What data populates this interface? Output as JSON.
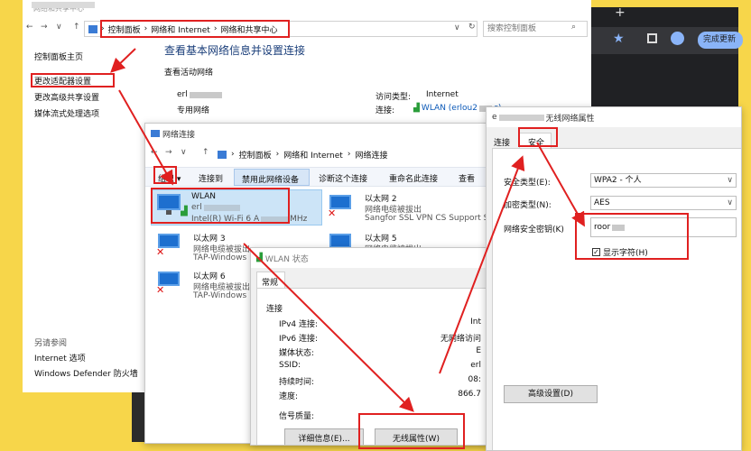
{
  "colors": {
    "accent": "#0a58b7",
    "highlight": "#e02020",
    "background": "#f7d64a",
    "chrome_dark": "#202124"
  },
  "main_window": {
    "title_fragment": "网络和共享中心",
    "breadcrumb": [
      "控制面板",
      "网络和 Internet",
      "网络和共享中心"
    ],
    "search_placeholder": "搜索控制面板",
    "sidebar": {
      "home": "控制面板主页",
      "change_adapter": "更改适配器设置",
      "change_sharing": "更改高级共享设置",
      "media": "媒体流式处理选项",
      "see_also": "另请参阅",
      "internet_options": "Internet 选项",
      "defender": "Windows Defender 防火墙"
    },
    "heading": "查看基本网络信息并设置连接",
    "active_networks": "查看活动网络",
    "network_name": "erl",
    "network_type": "专用网络",
    "access_type_label": "访问类型:",
    "access_type_value": "Internet",
    "connection_label": "连接:",
    "connection_value": "WLAN (erlou2",
    "connection_value_tail": "c)"
  },
  "chrome": {
    "new_tab": "+",
    "finish_update": "完成更新"
  },
  "network_connections": {
    "title": "网络连接",
    "breadcrumb": [
      "控制面板",
      "网络和 Internet",
      "网络连接"
    ],
    "toolbar": [
      "组织 ▾",
      "连接到",
      "禁用此网络设备",
      "诊断这个连接",
      "重命名此连接",
      "查看"
    ],
    "adapters": [
      {
        "name": "WLAN",
        "line1": "erl",
        "line2": "Intel(R) Wi-Fi 6 A",
        "line2_tail": "MHz"
      },
      {
        "name": "以太网 2",
        "line1": "网络电缆被拔出",
        "line2": "Sangfor SSL VPN CS Support S"
      },
      {
        "name": "以太网 3",
        "line1": "网络电缆被拔出",
        "line2": "TAP-Windows"
      },
      {
        "name": "以太网 5",
        "line1": "网络电缆被拔出",
        "line2": ""
      },
      {
        "name": "以太网 6",
        "line1": "网络电缆被拔出",
        "line2": "TAP-Windows"
      }
    ]
  },
  "wlan_status": {
    "title": "WLAN 状态",
    "tab": "常规",
    "section": "连接",
    "rows": [
      {
        "label": "IPv4 连接:",
        "value": "Int"
      },
      {
        "label": "IPv6 连接:",
        "value": "无网络访问"
      },
      {
        "label": "媒体状态:",
        "value": "E"
      },
      {
        "label": "SSID:",
        "value": "erl"
      },
      {
        "label": "持续时间:",
        "value": "08:"
      },
      {
        "label": "速度:",
        "value": "866.7"
      }
    ],
    "signal_label": "信号质量:",
    "details_button": "详细信息(E)...",
    "wireless_button": "无线属性(W)"
  },
  "wireless_props": {
    "title_prefix": "e",
    "title": "无线网络属性",
    "tabs": [
      "连接",
      "安全"
    ],
    "security_type_label": "安全类型(E):",
    "security_type_value": "WPA2 - 个人",
    "encryption_label": "加密类型(N):",
    "encryption_value": "AES",
    "key_label": "网络安全密钥(K)",
    "key_value": "roor",
    "show_chars": "显示字符(H)",
    "show_chars_checked": true,
    "advanced_button": "高级设置(D)"
  }
}
